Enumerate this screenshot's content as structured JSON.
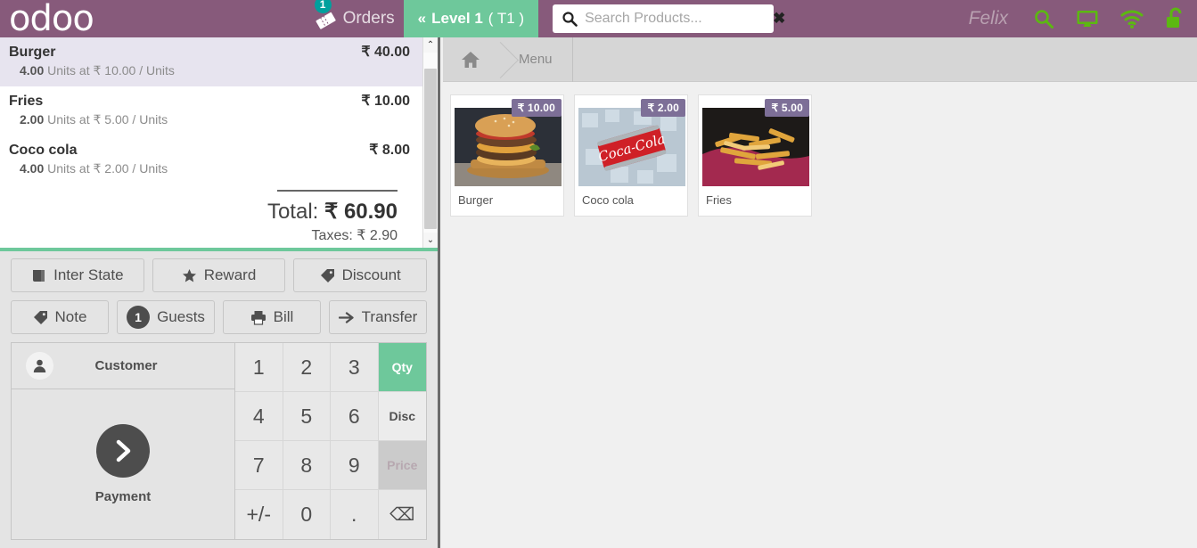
{
  "topbar": {
    "logo_text": "odoo",
    "orders": {
      "label": "Orders",
      "badge": "1",
      "icon": "ticket-icon"
    },
    "level_button": {
      "chevron": "«",
      "label": "Level 1",
      "table": "( T1 )"
    },
    "search": {
      "placeholder": "Search Products...",
      "value": "",
      "clear": "✖",
      "icon": "search-icon"
    },
    "username": "Felix",
    "icons": [
      "search-icon",
      "monitor-icon",
      "wifi-icon",
      "unlock-icon"
    ],
    "colors": {
      "bar_purple": "#875a7b",
      "accent_green": "#6ec89b",
      "badge_teal": "#00a09d",
      "icon_green": "#5cb811"
    }
  },
  "order": {
    "lines": [
      {
        "name": "Burger",
        "price": "₹ 40.00",
        "qty": "4.00",
        "detail": "Units at ₹ 10.00 / Units",
        "selected": true
      },
      {
        "name": "Fries",
        "price": "₹ 10.00",
        "qty": "2.00",
        "detail": "Units at ₹ 5.00 / Units",
        "selected": false
      },
      {
        "name": "Coco cola",
        "price": "₹ 8.00",
        "qty": "4.00",
        "detail": "Units at ₹ 2.00 / Units",
        "selected": false
      }
    ],
    "total_label": "Total:",
    "total_value": "₹ 60.90",
    "taxes_text": "Taxes: ₹ 2.90",
    "scroll_up": "⌃",
    "scroll_down": "⌄"
  },
  "actions": {
    "row1": [
      {
        "label": "Inter State",
        "icon": "book-icon"
      },
      {
        "label": "Reward",
        "icon": "star-icon"
      },
      {
        "label": "Discount",
        "icon": "tag-icon"
      }
    ],
    "row2": [
      {
        "label": "Note",
        "icon": "tag-icon"
      },
      {
        "label": "Guests",
        "icon": "guest-count-badge",
        "badge": "1"
      },
      {
        "label": "Bill",
        "icon": "printer-icon"
      },
      {
        "label": "Transfer",
        "icon": "arrow-right-icon"
      }
    ]
  },
  "pad": {
    "customer_label": "Customer",
    "payment_label": "Payment",
    "keys": [
      {
        "label": "1",
        "type": "num"
      },
      {
        "label": "2",
        "type": "num"
      },
      {
        "label": "3",
        "type": "num"
      },
      {
        "label": "Qty",
        "type": "mode",
        "state": "active"
      },
      {
        "label": "4",
        "type": "num"
      },
      {
        "label": "5",
        "type": "num"
      },
      {
        "label": "6",
        "type": "num"
      },
      {
        "label": "Disc",
        "type": "mode",
        "state": ""
      },
      {
        "label": "7",
        "type": "num"
      },
      {
        "label": "8",
        "type": "num"
      },
      {
        "label": "9",
        "type": "num"
      },
      {
        "label": "Price",
        "type": "mode",
        "state": "disabled"
      },
      {
        "label": "+/-",
        "type": "num"
      },
      {
        "label": "0",
        "type": "num"
      },
      {
        "label": ".",
        "type": "num"
      },
      {
        "label": "⌫",
        "type": "backspace",
        "state": ""
      }
    ]
  },
  "breadcrumb": {
    "home_icon": "home-icon",
    "items": [
      "Menu"
    ]
  },
  "products": [
    {
      "name": "Burger",
      "price": "₹ 10.00",
      "image": "burger-photo"
    },
    {
      "name": "Coco cola",
      "price": "₹ 2.00",
      "image": "coca-cola-can-photo"
    },
    {
      "name": "Fries",
      "price": "₹ 5.00",
      "image": "fries-photo"
    }
  ]
}
